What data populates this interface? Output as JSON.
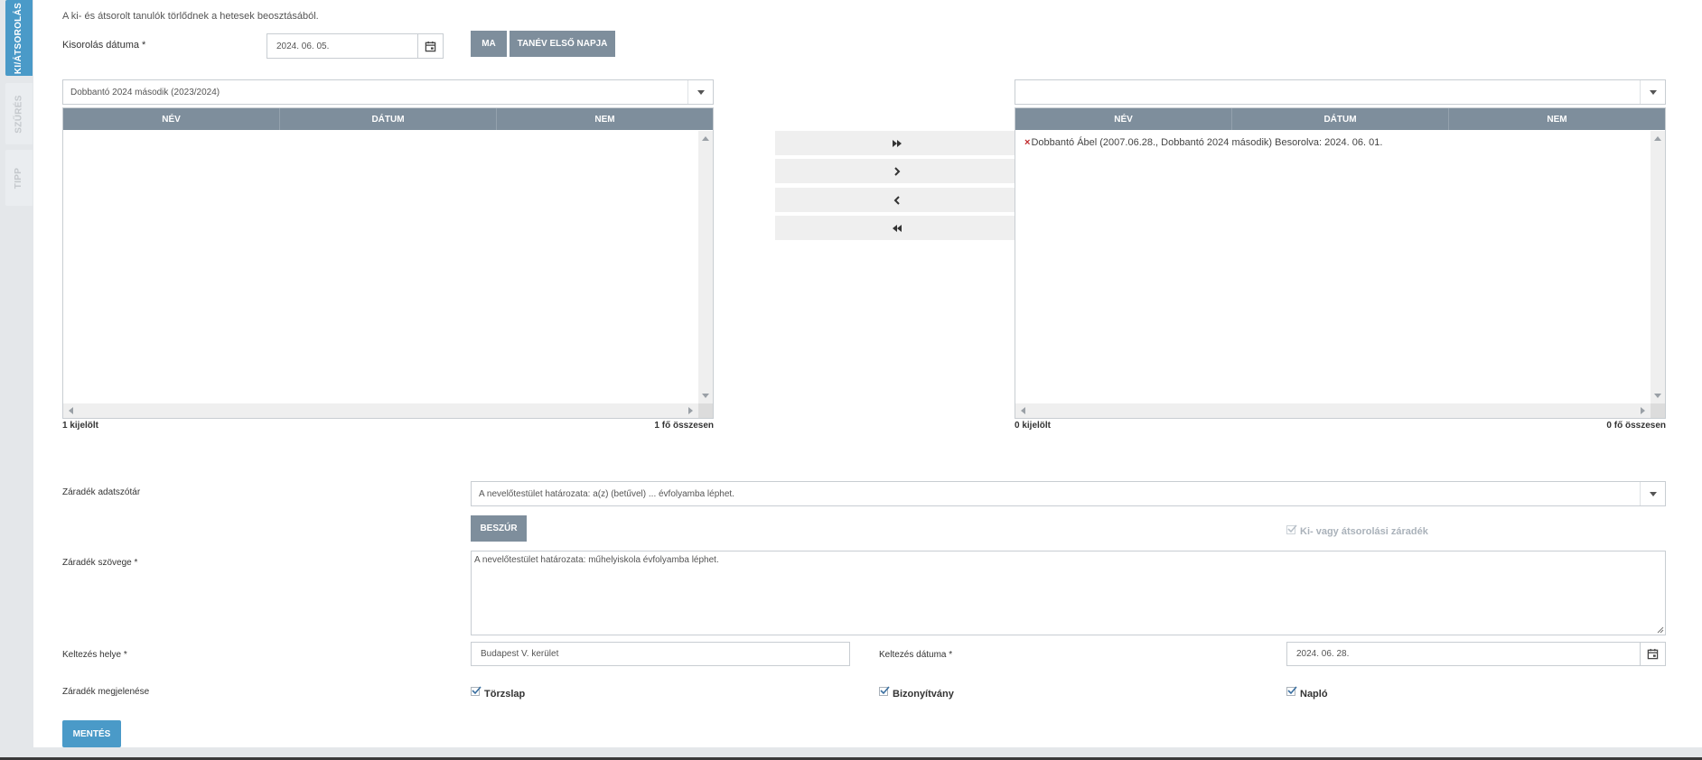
{
  "sidebar": {
    "tabs": [
      {
        "label": "KI/ÁTSOROLÁS"
      },
      {
        "label": "SZŰRÉS"
      },
      {
        "label": "TIPP"
      }
    ]
  },
  "form": {
    "info_text": "A ki- és átsorolt tanulók törlődnek a hetesek beosztásából.",
    "kisorolas_label": "Kisorolás dátuma *",
    "kisorolas_value": "2024. 06. 05.",
    "btn_ma": "MA",
    "btn_tanev": "TANÉV ELSŐ NAPJA"
  },
  "left_panel": {
    "select_value": "Dobbantó 2024 második (2023/2024)",
    "columns": [
      "NÉV",
      "DÁTUM",
      "NEM"
    ],
    "selected_count": "1 kijelölt",
    "total_count": "1 fő összesen"
  },
  "right_panel": {
    "select_value": "",
    "columns": [
      "NÉV",
      "DÁTUM",
      "NEM"
    ],
    "items": [
      {
        "remove": "×",
        "text": "Dobbantó Ábel (2007.06.28., Dobbantó 2024 második) Besorolva: 2024. 06. 01."
      }
    ],
    "selected_count": "0 kijelölt",
    "total_count": "0 fő összesen"
  },
  "move_buttons": [
    {
      "icon": "double-chevron-right-icon"
    },
    {
      "icon": "chevron-right-icon"
    },
    {
      "icon": "chevron-left-icon"
    },
    {
      "icon": "double-chevron-left-icon"
    }
  ],
  "zaradek": {
    "adatszotar_label": "Záradék adatszótár",
    "adatszotar_value": "A nevelőtestület határozata: a(z) (betűvel) ... évfolyamba léphet.",
    "btn_beszur": "BESZÚR",
    "ki_atsorolasi_label": "Ki- vagy átsorolási záradék",
    "szoveg_label": "Záradék szövege *",
    "szoveg_value": "A nevelőtestület határozata: műhelyiskola évfolyamba léphet.",
    "keltezes_helye_label": "Keltezés helye *",
    "keltezes_helye_value": "Budapest V. kerület",
    "keltezes_datuma_label": "Keltezés dátuma *",
    "keltezes_datuma_value": "2024. 06. 28.",
    "megjelenes_label": "Záradék megjelenése",
    "torzslap": "Törzslap",
    "bizonyitvany": "Bizonyítvány",
    "naplo": "Napló",
    "btn_mentes": "MENTÉS"
  },
  "colors": {
    "accent": "#4a9ac8",
    "header_gray": "#7e8e9c",
    "remove_red": "#c0282a"
  }
}
